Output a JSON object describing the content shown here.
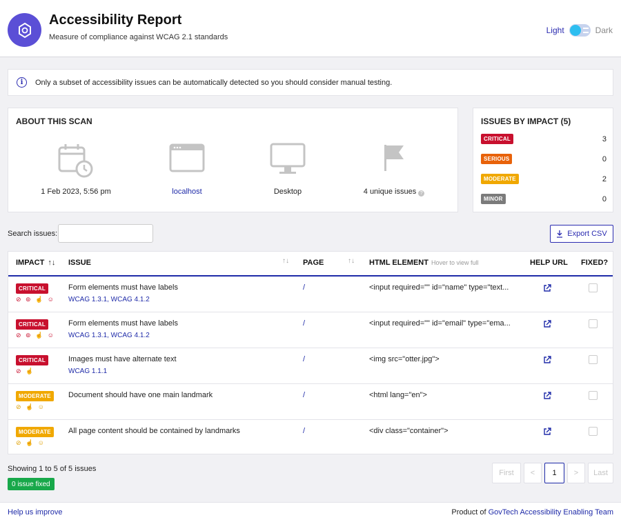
{
  "header": {
    "title": "Accessibility Report",
    "subtitle": "Measure of compliance against WCAG 2.1 standards",
    "theme_light": "Light",
    "theme_dark": "Dark"
  },
  "notice": "Only a subset of accessibility issues can be automatically detected so you should consider manual testing.",
  "about": {
    "heading": "ABOUT THIS SCAN",
    "date": "1 Feb 2023, 5:56 pm",
    "page": "localhost",
    "device": "Desktop",
    "unique": "4 unique issues"
  },
  "impact": {
    "heading": "ISSUES BY IMPACT (5)",
    "rows": [
      {
        "label": "CRITICAL",
        "count": "3"
      },
      {
        "label": "SERIOUS",
        "count": "0"
      },
      {
        "label": "MODERATE",
        "count": "2"
      },
      {
        "label": "MINOR",
        "count": "0"
      }
    ]
  },
  "search": {
    "label": "Search issues:",
    "value": ""
  },
  "export_label": "Export CSV",
  "table": {
    "headers": {
      "impact": "IMPACT",
      "issue": "ISSUE",
      "page": "PAGE",
      "html": "HTML ELEMENT",
      "html_sub": "Hover to view full",
      "help": "HELP URL",
      "fixed": "FIXED?"
    },
    "rows": [
      {
        "impact": "CRITICAL",
        "icons": "👁̸ 👓 ✋ 🧠",
        "issue": "Form elements must have labels",
        "wcag": "WCAG 1.3.1, WCAG 4.1.2",
        "page": "/",
        "html": "<input required=\"\" id=\"name\" type=\"text..."
      },
      {
        "impact": "CRITICAL",
        "icons": "👁̸ 👓 ✋ 🧠",
        "issue": "Form elements must have labels",
        "wcag": "WCAG 1.3.1, WCAG 4.1.2",
        "page": "/",
        "html": "<input required=\"\" id=\"email\" type=\"ema..."
      },
      {
        "impact": "CRITICAL",
        "icons": "👁̸ ✋",
        "issue": "Images must have alternate text",
        "wcag": "WCAG 1.1.1",
        "page": "/",
        "html": "<img src=\"otter.jpg\">"
      },
      {
        "impact": "MODERATE",
        "icons": "👁̸ ✋ 🧠",
        "issue": "Document should have one main landmark",
        "wcag": "",
        "page": "/",
        "html": "<html lang=\"en\">"
      },
      {
        "impact": "MODERATE",
        "icons": "👁̸ ✋ 🧠",
        "issue": "All page content should be contained by landmarks",
        "wcag": "",
        "page": "/",
        "html": "<div class=\"container\">"
      }
    ]
  },
  "showing": "Showing 1 to 5 of 5 issues",
  "fixed_badge": "0 issue fixed",
  "pagination": {
    "first": "First",
    "prev": "<",
    "current": "1",
    "next": ">",
    "last": "Last"
  },
  "footer": {
    "help": "Help us improve",
    "product_prefix": "Product of ",
    "product_link": "GovTech Accessibility Enabling Team"
  },
  "colors": {
    "accent": "#1e2aa8",
    "critical": "#c8102e",
    "serious": "#e8620a",
    "moderate": "#f0a800",
    "minor": "#7b7b7b",
    "fixed": "#18a84a"
  }
}
